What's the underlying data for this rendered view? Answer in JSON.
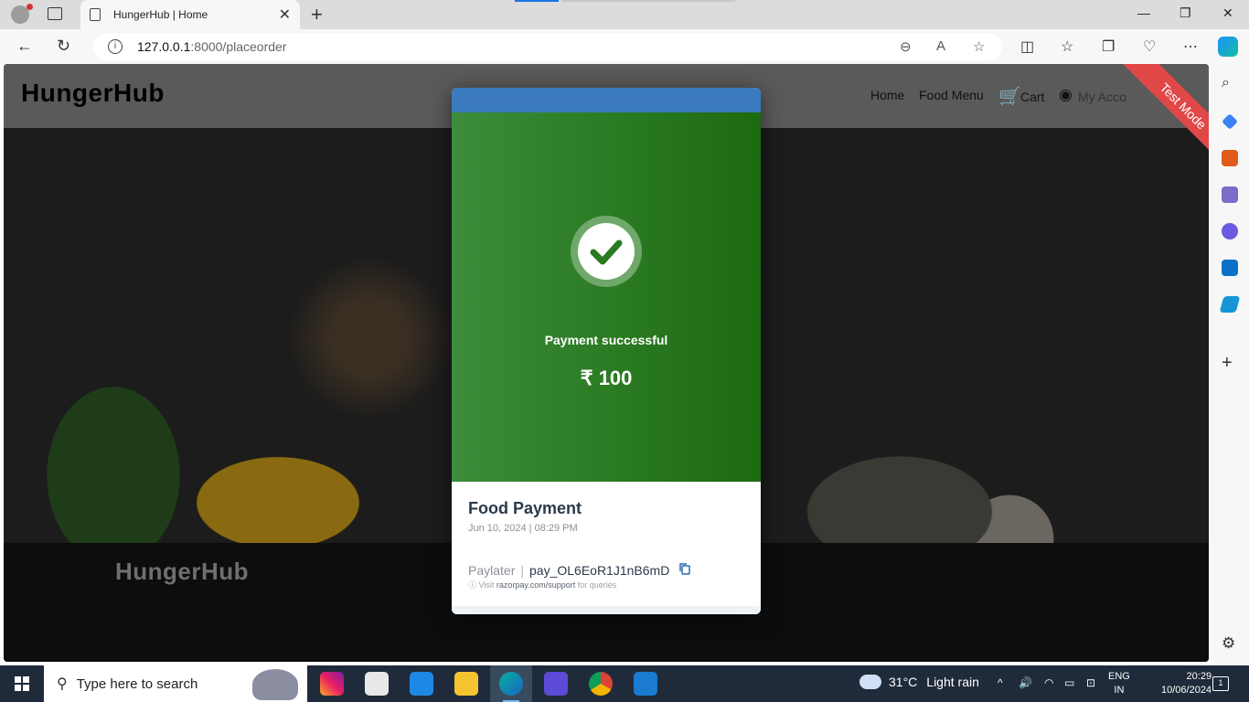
{
  "browser": {
    "tab_title": "HungerHub | Home",
    "tab_close": "✕",
    "new_tab": "+",
    "url_host": "127.0.0.1",
    "url_path": ":8000/placeorder",
    "win_minimize": "—",
    "win_restore": "❐",
    "win_close": "✕"
  },
  "site": {
    "brand": "HungerHub",
    "nav": {
      "home": "Home",
      "food_menu": "Food Menu",
      "cart": "Cart",
      "account": "My Acco"
    },
    "test_mode": "Test Mode",
    "footer_brand": "HungerHub"
  },
  "payment": {
    "status": "Payment successful",
    "amount": "₹ 100",
    "merchant": "Food Payment",
    "datetime": "Jun 10, 2024 | 08:29 PM",
    "method": "Paylater",
    "payment_id": "pay_OL6EoR1J1nB6mD",
    "support_prefix": "Visit",
    "support_link": "razorpay.com/support",
    "support_suffix": "for queries",
    "success_color": "#2a7a22"
  },
  "taskbar": {
    "search_placeholder": "Type here to search",
    "weather_temp": "31°C",
    "weather_desc": "Light rain",
    "lang_line1": "ENG",
    "lang_line2": "IN",
    "time": "20:29",
    "date": "10/06/2024",
    "notification_count": "1"
  }
}
